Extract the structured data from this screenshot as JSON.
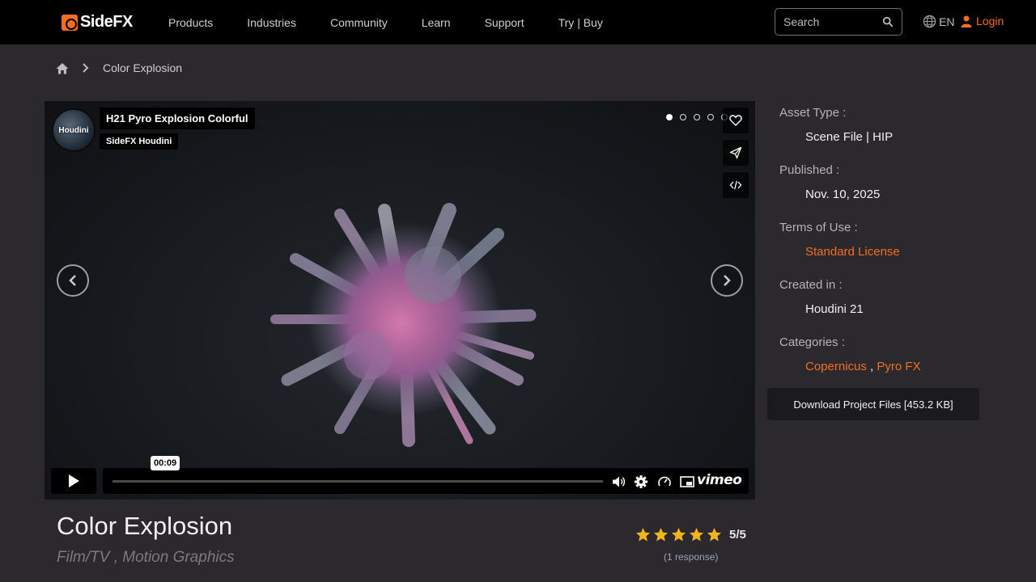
{
  "nav": {
    "logo_text": "SideFX",
    "links": [
      "Products",
      "Industries",
      "Community",
      "Learn",
      "Support",
      "Try | Buy"
    ],
    "search_placeholder": "Search",
    "language": "EN",
    "login": "Login",
    "accent": "#f26f21"
  },
  "breadcrumb": {
    "current": "Color Explosion"
  },
  "video": {
    "avatar_label": "Houdini",
    "title": "H21 Pyro Explosion Colorful",
    "channel": "SideFX Houdini",
    "timestamp": "00:09",
    "brand": "vimeo",
    "slide_count": 5,
    "active_slide": 1
  },
  "asset": {
    "title": "Color Explosion",
    "subtitle": "Film/TV , Motion Graphics",
    "rating_value": "5/5",
    "stars": 5,
    "responses": "(1 response)"
  },
  "details": {
    "asset_type_label": "Asset Type :",
    "asset_type": "Scene File | HIP",
    "published_label": "Published :",
    "published": "Nov. 10, 2025",
    "terms_label": "Terms of Use :",
    "terms": "Standard License",
    "created_label": "Created in :",
    "created": "Houdini 21",
    "categories_label": "Categories :",
    "category_1": "Copernicus",
    "category_sep": " , ",
    "category_2": "Pyro FX",
    "download": "Download Project Files [453.2 KB]"
  }
}
